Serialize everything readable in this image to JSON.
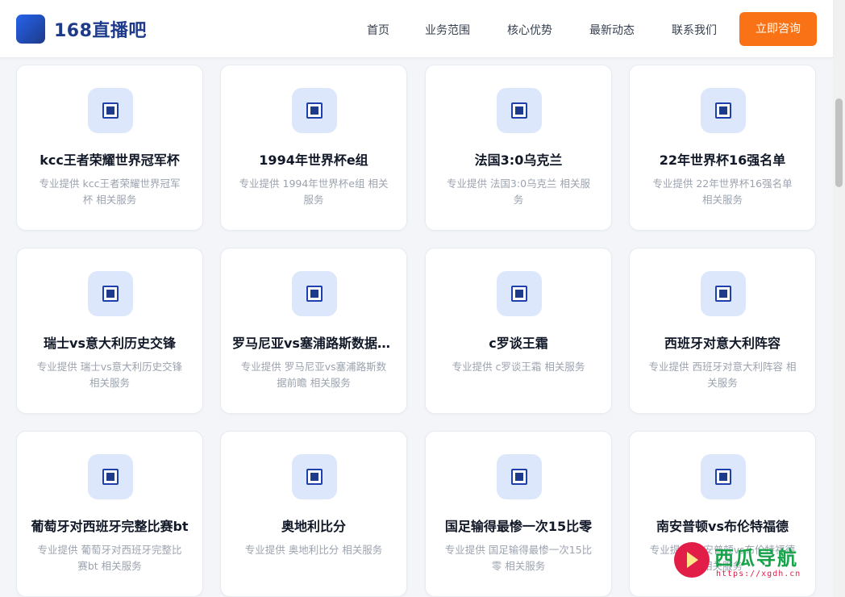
{
  "header": {
    "logo_text": "168直播吧",
    "nav": [
      "首页",
      "业务范围",
      "核心优势",
      "最新动态",
      "联系我们"
    ],
    "cta_label": "立即咨询",
    "brand_color": "#1e3a8a",
    "cta_color": "#f97316"
  },
  "cards": [
    {
      "title": "kcc王者荣耀世界冠军杯",
      "desc": "专业提供 kcc王者荣耀世界冠军杯 相关服务"
    },
    {
      "title": "1994年世界杯e组",
      "desc": "专业提供 1994年世界杯e组 相关服务"
    },
    {
      "title": "法国3:0乌克兰",
      "desc": "专业提供 法国3:0乌克兰 相关服务"
    },
    {
      "title": "22年世界杯16强名单",
      "desc": "专业提供 22年世界杯16强名单 相关服务"
    },
    {
      "title": "瑞士vs意大利历史交锋",
      "desc": "专业提供 瑞士vs意大利历史交锋 相关服务"
    },
    {
      "title": "罗马尼亚vs塞浦路斯数据前瞻",
      "desc": "专业提供 罗马尼亚vs塞浦路斯数据前瞻 相关服务"
    },
    {
      "title": "c罗谈王霜",
      "desc": "专业提供 c罗谈王霜 相关服务"
    },
    {
      "title": "西班牙对意大利阵容",
      "desc": "专业提供 西班牙对意大利阵容 相关服务"
    },
    {
      "title": "葡萄牙对西班牙完整比赛bt",
      "desc": "专业提供 葡萄牙对西班牙完整比赛bt 相关服务"
    },
    {
      "title": "奥地利比分",
      "desc": "专业提供 奥地利比分 相关服务"
    },
    {
      "title": "国足输得最惨一次15比零",
      "desc": "专业提供 国足输得最惨一次15比零 相关服务"
    },
    {
      "title": "南安普顿vs布伦特福德",
      "desc": "专业提供 南安普顿vs布伦特福德 相关服务"
    }
  ],
  "card_icon": "square-dot-icon",
  "watermark": {
    "name": "西瓜导航",
    "url": "https://xgdh.cn"
  }
}
